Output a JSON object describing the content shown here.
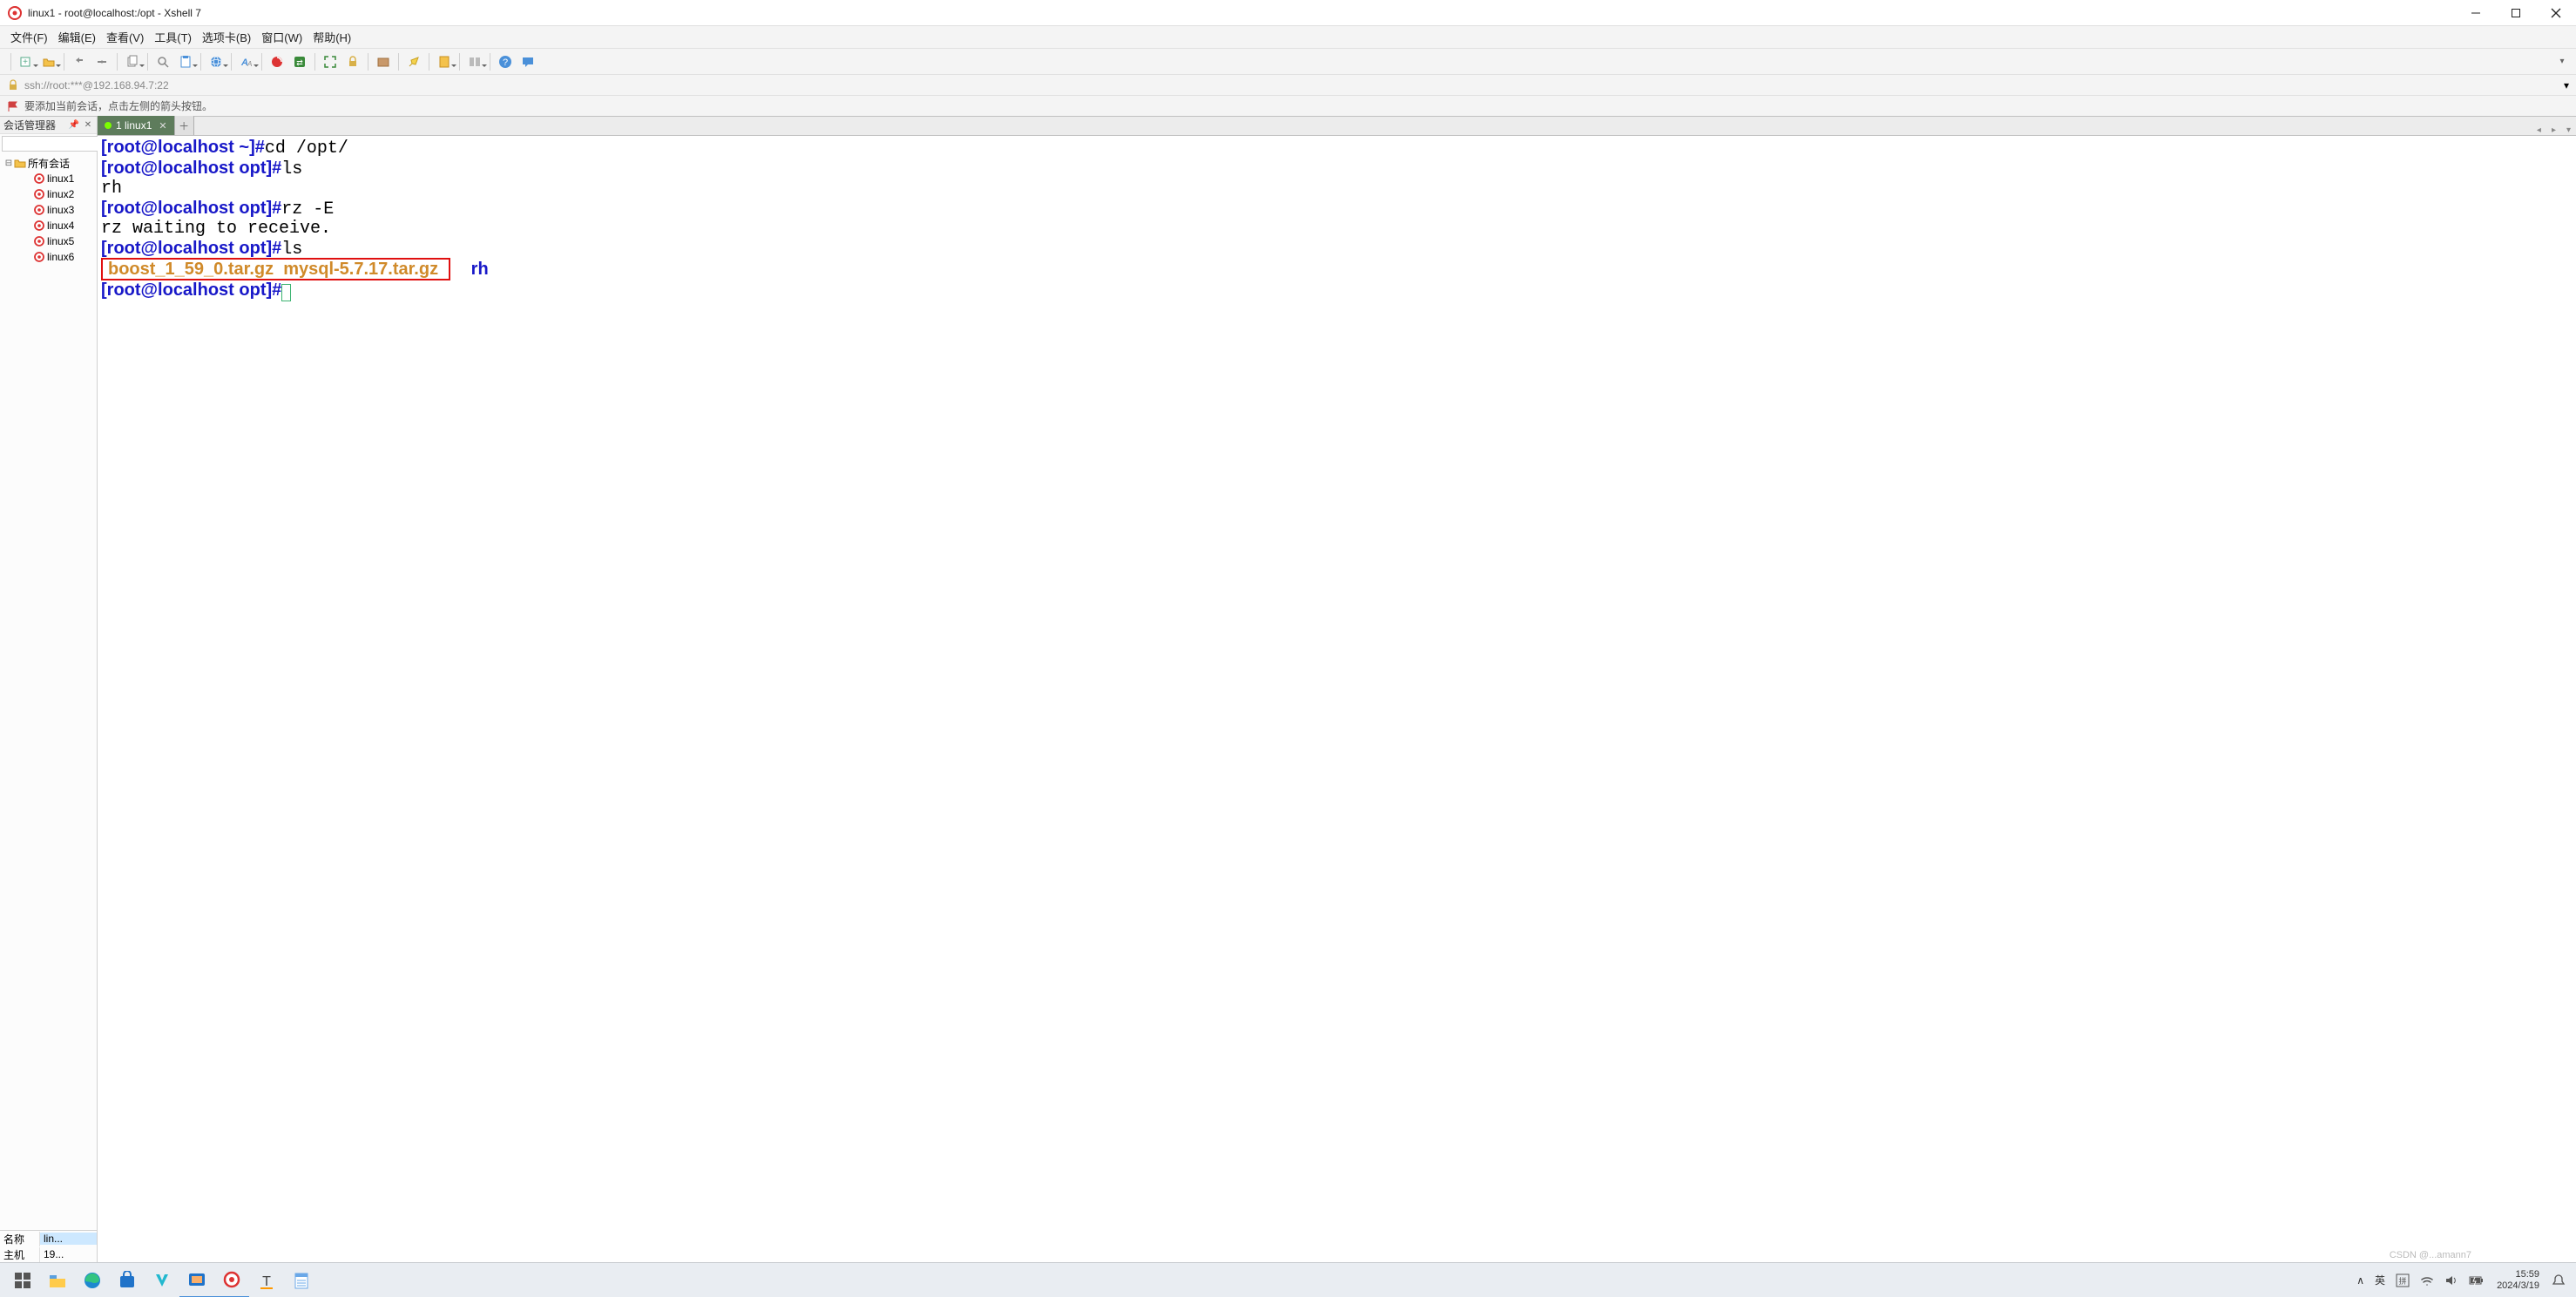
{
  "window": {
    "title": "linux1 - root@localhost:/opt - Xshell 7"
  },
  "menu": {
    "file": "文件(F)",
    "edit": "编辑(E)",
    "view": "查看(V)",
    "tools": "工具(T)",
    "tabs": "选项卡(B)",
    "window": "窗口(W)",
    "help": "帮助(H)"
  },
  "addressbar": {
    "url": "ssh://root:***@192.168.94.7:22"
  },
  "hintbar": {
    "text": "要添加当前会话，点击左侧的箭头按钮。"
  },
  "sessionpane": {
    "title": "会话管理器",
    "root": "所有会话",
    "items": [
      "linux1",
      "linux2",
      "linux3",
      "linux4",
      "linux5",
      "linux6"
    ],
    "detail_name_label": "名称",
    "detail_name_value": "lin...",
    "detail_host_label": "主机",
    "detail_host_value": "19..."
  },
  "tabs": {
    "active_label": "1 linux1"
  },
  "terminal": {
    "lines": [
      {
        "prompt": "[root@localhost ~]#",
        "cmd": "cd /opt/"
      },
      {
        "prompt": "[root@localhost opt]#",
        "cmd": "ls"
      },
      {
        "plain": "rh"
      },
      {
        "prompt": "[root@localhost opt]#",
        "cmd": "rz -E"
      },
      {
        "plain": "rz waiting to receive."
      },
      {
        "prompt": "[root@localhost opt]#",
        "cmd": "ls"
      },
      {
        "boxed_archives": [
          "boost_1_59_0.tar.gz",
          "mysql-5.7.17.tar.gz"
        ],
        "trailing_dir": "rh"
      },
      {
        "prompt": "[root@localhost opt]#",
        "cursor": true
      }
    ]
  },
  "tray": {
    "ime_up": "∧",
    "ime_lang": "英",
    "time": "15:59",
    "date": "2024/3/19"
  },
  "watermark": "CSDN @...amann7"
}
